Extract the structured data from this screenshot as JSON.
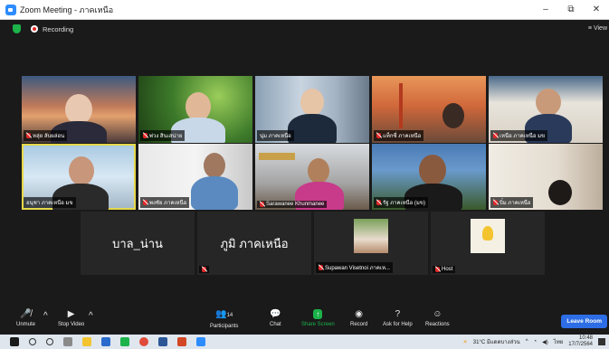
{
  "window": {
    "title": "Zoom Meeting - ภาคเหนือ",
    "minimize": "–",
    "maximize": "⧉",
    "close": "✕"
  },
  "topbar": {
    "recording_label": "Recording",
    "view_label": "≡ View"
  },
  "participants": [
    {
      "name": "หลุ่ย ลับผล่อน",
      "muted": true
    },
    {
      "name": "พ่วง สินเสน่าย",
      "muted": true
    },
    {
      "name": "นุ่ม ภาคเหนือ",
      "muted": false
    },
    {
      "name": "แท็กซี่ ภาคเหนือ",
      "muted": true
    },
    {
      "name": "เหนือ ภาคเหนือ มข",
      "muted": true
    },
    {
      "name": "อนุชา ภาคเหนือ มข",
      "muted": false
    },
    {
      "name": "พงชัย ภาคเหนือ",
      "muted": true
    },
    {
      "name": "Sarawanee Khunmanee",
      "muted": true
    },
    {
      "name": "รัฐ ภาคเหนือ (มข)",
      "muted": true
    },
    {
      "name": "บิ๋ม ภาคเหนือ",
      "muted": true
    },
    {
      "name": "บาล_น่าน",
      "muted": false,
      "display": "บาล_น่าน"
    },
    {
      "name": "",
      "muted": true,
      "display": "ภูมิ ภาคเหนือ"
    },
    {
      "name": "Supawan Visetnoi ภาคเห...",
      "muted": true
    },
    {
      "name": "Host",
      "muted": true
    }
  ],
  "toolbar": {
    "unmute": "Unmute",
    "stop_video": "Stop Video",
    "participants": "Participants",
    "participants_count": "14",
    "chat": "Chat",
    "share_screen": "Share Screen",
    "record": "Record",
    "ask_for_help": "Ask for Help",
    "reactions": "Reactions",
    "leave": "Leave Room"
  },
  "taskbar": {
    "weather": "31°C มีแดดบางส่วน",
    "lang": "ไทย",
    "time": "10:48",
    "date": "17/7/2564"
  },
  "colors": {
    "accent_blue": "#2d6ee6",
    "share_green": "#1bb34a",
    "active_speaker": "#e5d84a",
    "mute_red": "#e02828"
  }
}
